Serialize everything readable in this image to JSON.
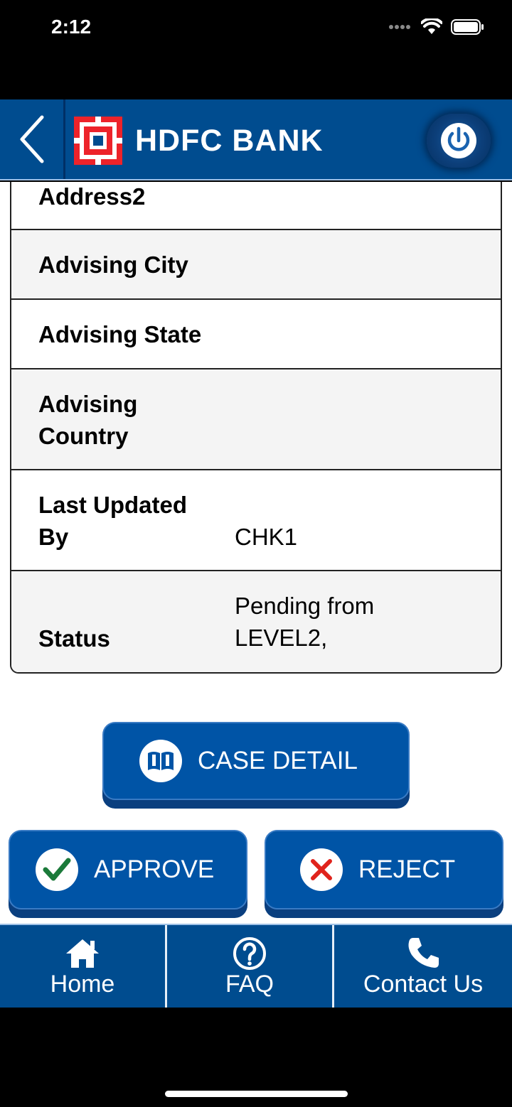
{
  "status_bar": {
    "time": "2:12"
  },
  "header": {
    "brand_name": "HDFC BANK",
    "back_icon": "chevron-left-icon",
    "power_icon": "power-icon",
    "brand_color": "#004c8f"
  },
  "details": {
    "rows": [
      {
        "label": "Address2",
        "value": ""
      },
      {
        "label": "Advising City",
        "value": ""
      },
      {
        "label": "Advising State",
        "value": ""
      },
      {
        "label": "Advising\nCountry",
        "value": ""
      },
      {
        "label": "Last Updated\nBy",
        "value": "CHK1"
      },
      {
        "label": "Status",
        "value": "Pending from\nLEVEL2,"
      }
    ]
  },
  "actions": {
    "case_detail_label": "CASE DETAIL",
    "approve_label": "APPROVE",
    "reject_label": "REJECT",
    "approve_color": "#1b7a3a",
    "reject_color": "#e0231c"
  },
  "bottom_nav": {
    "home_label": "Home",
    "faq_label": "FAQ",
    "contact_label": "Contact Us"
  }
}
